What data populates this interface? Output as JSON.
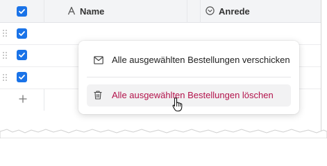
{
  "table": {
    "columns": [
      {
        "label": "Name",
        "icon": "text-field-icon"
      },
      {
        "label": "Anrede",
        "icon": "single-select-icon"
      }
    ],
    "rows_selected": [
      true,
      true,
      true
    ],
    "add_row_icon": "plus-icon"
  },
  "context_menu": {
    "items": [
      {
        "label": "Alle ausgewählten Bestellungen verschicken",
        "icon": "mail-icon"
      },
      {
        "label": "Alle ausgewählten Bestellungen löschen",
        "icon": "trash-icon",
        "style": "danger"
      }
    ]
  },
  "colors": {
    "accent": "#1a73e8",
    "danger_text": "#b3124b",
    "header_bg": "#f3f4f6"
  }
}
